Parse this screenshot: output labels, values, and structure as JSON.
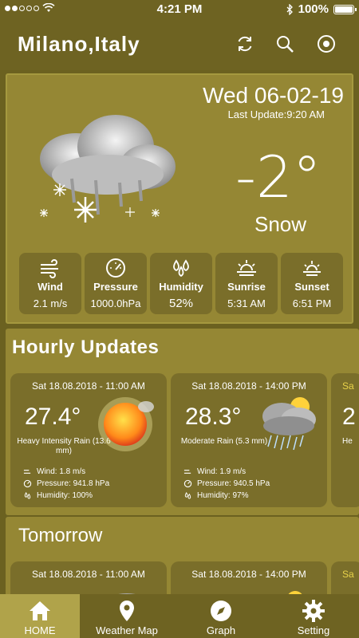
{
  "status_bar": {
    "time": "4:21 PM",
    "battery": "100%"
  },
  "header": {
    "city": "Milano,Italy"
  },
  "current": {
    "date": "Wed 06-02-19",
    "last_update": "Last Update:9:20 AM",
    "temperature": "-2°",
    "condition": "Snow",
    "stats": [
      {
        "icon": "wind-icon",
        "label": "Wind",
        "value": "2.1 m/s"
      },
      {
        "icon": "pressure-gauge-icon",
        "label": "Pressure",
        "value": "1000.0hPa"
      },
      {
        "icon": "humidity-drops-icon",
        "label": "Humidity",
        "value": "52%"
      },
      {
        "icon": "sunrise-icon",
        "label": "Sunrise",
        "value": "5:31 AM"
      },
      {
        "icon": "sunset-icon",
        "label": "Sunset",
        "value": "6:51 PM"
      }
    ]
  },
  "hourly": {
    "title": "Hourly Updates",
    "cards": [
      {
        "date": "Sat 18.08.2018 - 11:00 AM",
        "temp": "27.4°",
        "desc": "Heavy Intensity Rain (13.6 mm)",
        "wind": "Wind: 1.8 m/s",
        "pressure": "Pressure: 941.8 hPa",
        "humidity": "Humidity: 100%",
        "icon": "sun-icon"
      },
      {
        "date": "Sat 18.08.2018 - 14:00 PM",
        "temp": "28.3°",
        "desc": "Moderate Rain (5.3 mm)",
        "wind": "Wind: 1.9 m/s",
        "pressure": "Pressure: 940.5 hPa",
        "humidity": "Humidity: 97%",
        "icon": "rain-cloud-icon"
      }
    ],
    "peek": {
      "date": "Sa",
      "temp": "2",
      "desc": "He"
    }
  },
  "tomorrow": {
    "title": "Tomorrow",
    "cards": [
      {
        "date": "Sat 18.08.2018 - 11:00 AM"
      },
      {
        "date": "Sat 18.08.2018 - 14:00 PM"
      }
    ],
    "peek": "Sa"
  },
  "nav": [
    {
      "label": "HOME",
      "icon": "home-icon",
      "active": true
    },
    {
      "label": "Weather Map",
      "icon": "map-pin-icon",
      "active": false
    },
    {
      "label": "Graph",
      "icon": "compass-icon",
      "active": false
    },
    {
      "label": "Setting",
      "icon": "gear-icon",
      "active": false
    }
  ]
}
